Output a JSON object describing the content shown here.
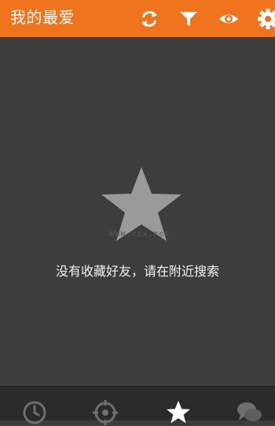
{
  "header": {
    "title": "我的最爱",
    "bg_color": "#f0731e",
    "icons": [
      "refresh-icon",
      "filter-icon",
      "eye-icon",
      "gear-icon"
    ]
  },
  "main": {
    "empty_icon": "star-icon",
    "empty_message": "没有收藏好友，请在附近搜索",
    "watermark": "WWW.xxx.net"
  },
  "tabbar": {
    "tabs": [
      {
        "icon": "clock-icon",
        "selected": false
      },
      {
        "icon": "location-target-icon",
        "selected": false
      },
      {
        "icon": "star-icon",
        "selected": true
      },
      {
        "icon": "chat-bubbles-icon",
        "selected": false
      }
    ]
  }
}
